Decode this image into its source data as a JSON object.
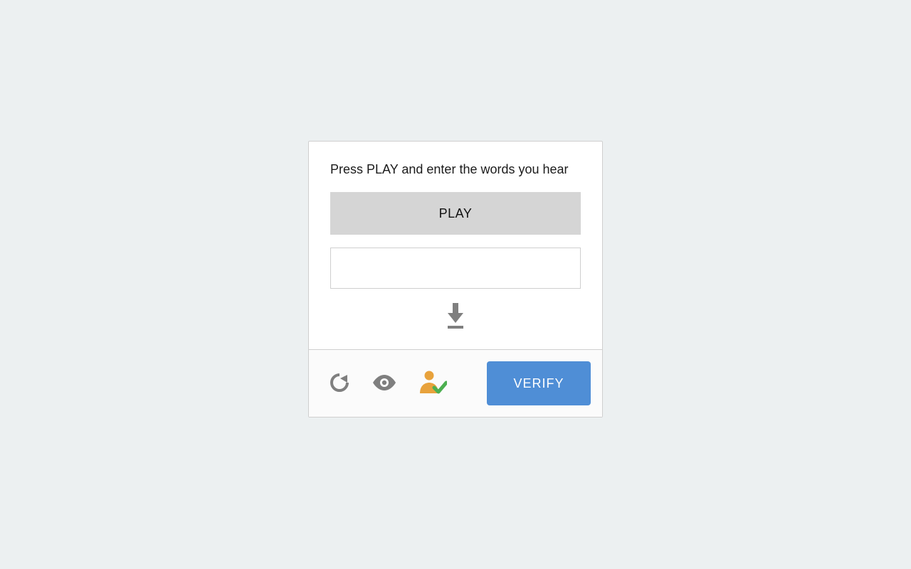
{
  "captcha": {
    "instructions": "Press PLAY and enter the words you hear",
    "play_label": "PLAY",
    "answer_value": "",
    "answer_placeholder": "",
    "verify_label": "VERIFY",
    "icons": {
      "download": "download-icon",
      "refresh": "refresh-icon",
      "visual": "eye-icon",
      "a11y": "person-check-icon"
    },
    "colors": {
      "page_bg": "#ecf0f1",
      "card_border": "#cfcfcf",
      "play_bg": "#d5d5d5",
      "verify_bg": "#4f8ed6",
      "icon_gray": "#7f7f7f",
      "a11y_orange": "#e8a23c",
      "a11y_green": "#4caf50"
    }
  }
}
